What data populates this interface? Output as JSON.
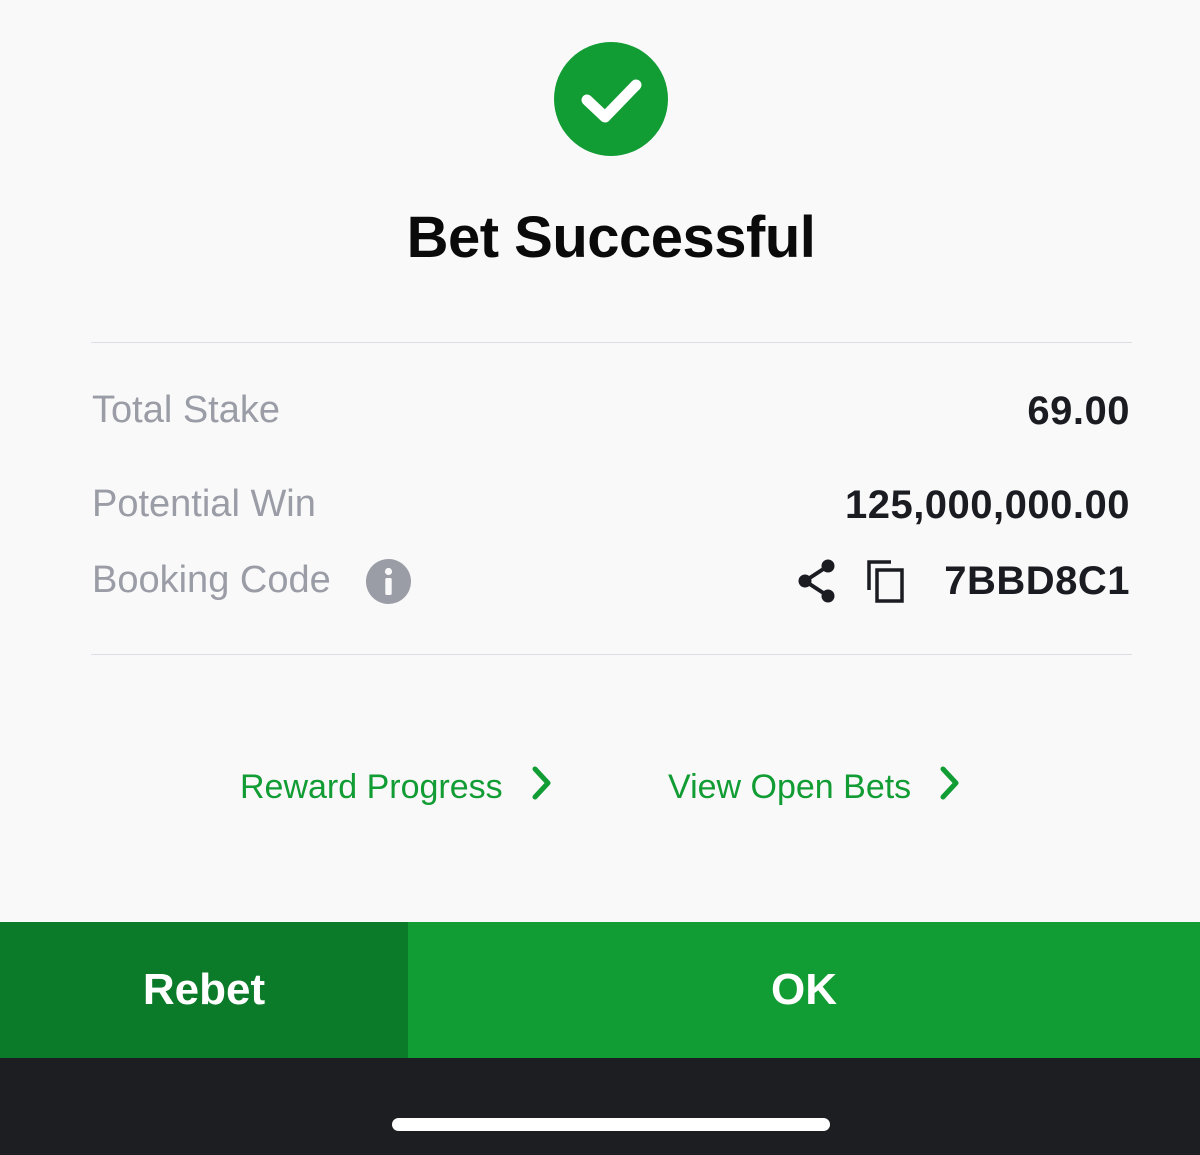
{
  "dialog": {
    "title": "Bet Successful",
    "status_color": "#129c34",
    "status_icon": "checkmark-icon"
  },
  "details": {
    "total_stake": {
      "label": "Total Stake",
      "value": "69.00"
    },
    "potential_win": {
      "label": "Potential Win",
      "value": "125,000,000.00"
    },
    "booking_code": {
      "label": "Booking Code",
      "value": "7BBD8C1",
      "icons": [
        "info-icon",
        "share-icon",
        "copy-icon"
      ]
    }
  },
  "links": {
    "reward_progress": "Reward Progress",
    "view_open_bets": "View Open Bets",
    "color": "#129c34"
  },
  "actions": {
    "rebet_label": "Rebet",
    "ok_label": "OK",
    "rebet_color": "#0b7a29",
    "ok_color": "#129c34"
  }
}
